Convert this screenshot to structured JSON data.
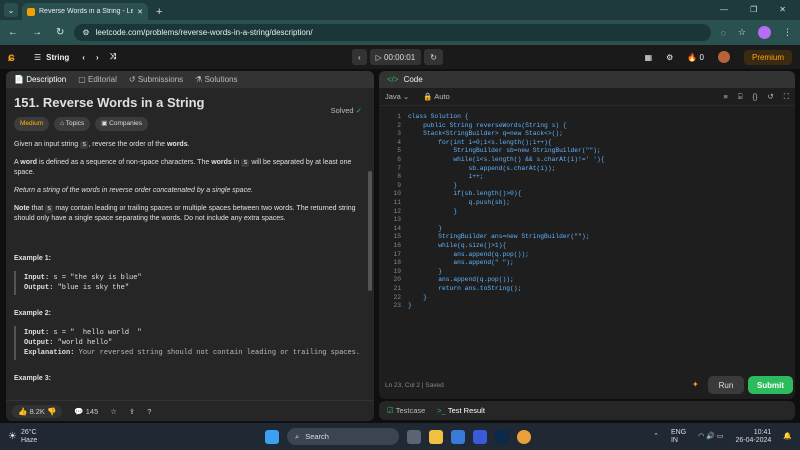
{
  "browser": {
    "tab_title": "Reverse Words in a String - Lee",
    "new_tab": "+",
    "url": "leetcode.com/problems/reverse-words-in-a-string/description/"
  },
  "leetcode_bar": {
    "list_label": "String",
    "timer": "00:00:01",
    "streak": "0",
    "premium": "Premium"
  },
  "left_tabs": [
    "Description",
    "Editorial",
    "Submissions",
    "Solutions"
  ],
  "problem": {
    "title": "151. Reverse Words in a String",
    "status": "Solved",
    "difficulty": "Medium",
    "topics": "Topics",
    "companies": "Companies",
    "p1_a": "Given an input string",
    "p1_code": "s",
    "p1_b": ", reverse the order of the",
    "p1_bold": "words",
    "p1_c": ".",
    "p2_a": "A",
    "p2_bold1": "word",
    "p2_b": "is defined as a sequence of non-space characters. The",
    "p2_bold2": "words",
    "p2_c": "in",
    "p2_code": "s",
    "p2_d": "will be separated by at least one space.",
    "p3": "Return a string of the words in reverse order concatenated by a single space.",
    "p4_bold": "Note",
    "p4_a": "that",
    "p4_code": "s",
    "p4_b": "may contain leading or trailing spaces or multiple spaces between two words. The returned string should only have a single space separating the words. Do not include any extra spaces.",
    "examples": [
      {
        "title": "Example 1:",
        "input": "s = \"the sky is blue\"",
        "output": "\"blue is sky the\"",
        "explanation": ""
      },
      {
        "title": "Example 2:",
        "input": "s = \"  hello world  \"",
        "output": "\"world hello\"",
        "explanation": "Your reversed string should not contain leading or trailing spaces."
      },
      {
        "title": "Example 3:",
        "input": "",
        "output": "",
        "explanation": ""
      }
    ],
    "input_label": "Input:",
    "output_label": "Output:",
    "explanation_label": "Explanation:"
  },
  "left_footer": {
    "likes": "8.2K",
    "comments": "145"
  },
  "code_panel": {
    "title": "Code",
    "language": "Java",
    "mode": "Auto",
    "lines": [
      "class Solution {",
      "    public String reverseWords(String s) {",
      "    Stack<StringBuilder> q=new Stack<>();",
      "        for(int i=0;i<s.length();i++){",
      "            StringBuilder sb=new StringBuilder(\"\");",
      "            while(i<s.length() && s.charAt(i)!=' '){",
      "                sb.append(s.charAt(i));",
      "                i++;",
      "            }",
      "            if(sb.length()>0){",
      "                q.push(sb);",
      "            }",
      "",
      "        }",
      "        StringBuilder ans=new StringBuilder(\"\");",
      "        while(q.size()>1){",
      "            ans.append(q.pop());",
      "            ans.append(\" \");",
      "        }",
      "        ans.append(q.pop());",
      "        return ans.toString();",
      "    }",
      "}"
    ],
    "status": "Ln 23, Col 2  |  Saved",
    "run": "Run",
    "submit": "Submit"
  },
  "testcase": {
    "tab1": "Testcase",
    "tab2": "Test Result"
  },
  "taskbar": {
    "temp": "26°C",
    "weather": "Haze",
    "search": "Search",
    "lang1": "ENG",
    "lang2": "IN",
    "time": "10:41",
    "date": "26-04-2024"
  }
}
